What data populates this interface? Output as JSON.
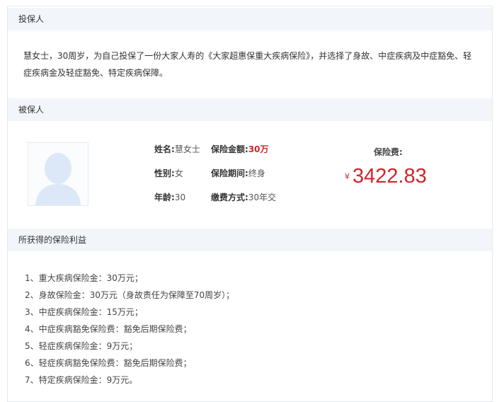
{
  "policyholder": {
    "heading": "投保人",
    "description": "慧女士，30周岁，为自己投保了一份大家人寿的《大家超惠保重大疾病保险》，并选择了身故、中症疾病及中症豁免、轻症疾病金及轻症豁免、特定疾病保障。"
  },
  "insured": {
    "heading": "被保人",
    "name_label": "姓名:",
    "name": "慧女士",
    "gender_label": "性别:",
    "gender": "女",
    "age_label": "年龄:",
    "age": "30",
    "sum_label": "保险金额:",
    "sum": "30万",
    "period_label": "保险期间:",
    "period": "终身",
    "payment_label": "缴费方式:",
    "payment": "30年交",
    "premium_label": "保险费:",
    "currency": "¥",
    "premium": "3422.83"
  },
  "benefits": {
    "heading": "所获得的保险利益",
    "items": [
      "1、重大疾病保险金：30万元；",
      "2、身故保险金：30万元（身故责任为保障至70周岁）；",
      "3、中症疾病保险金：15万元；",
      "4、中症疾病豁免保险费：豁免后期保险费；",
      "5、轻症疾病保险金：9万元；",
      "6、轻症疾病豁免保险费：豁免后期保险费；",
      "7、特定疾病保险金：9万元。"
    ]
  },
  "colors": {
    "accent_red": "#d2242a",
    "header_bg": "#f2f6fb"
  }
}
